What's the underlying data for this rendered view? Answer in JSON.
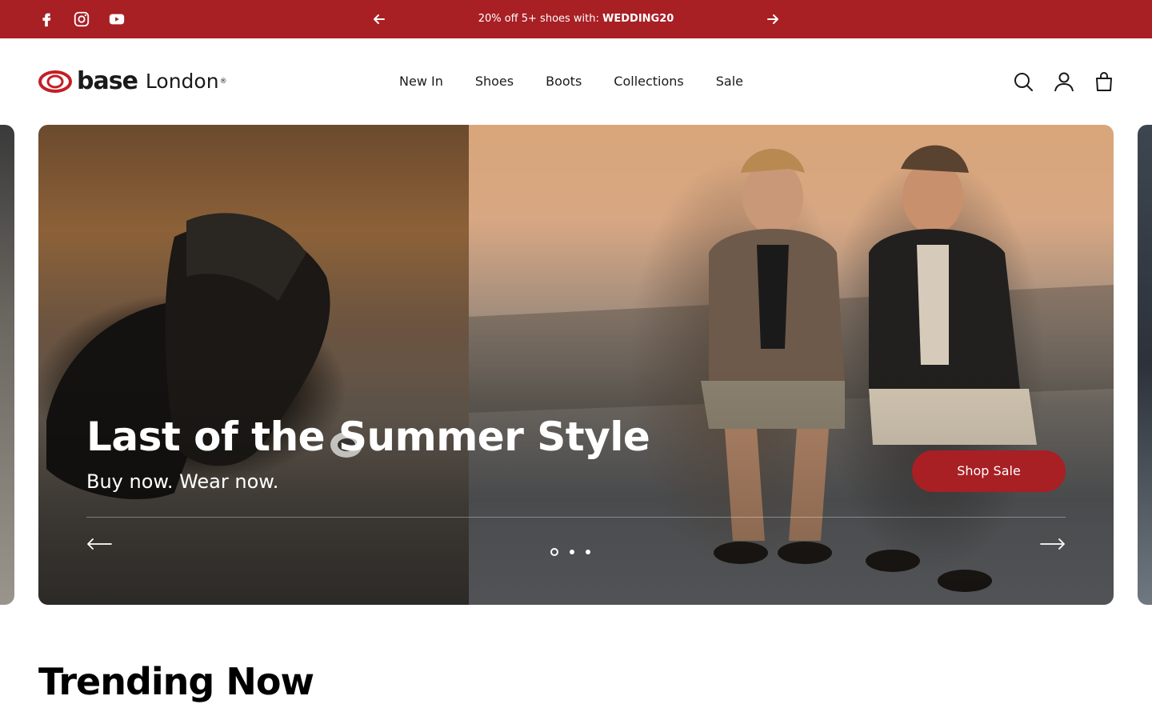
{
  "announcement": {
    "text_prefix": "20% off 5+ shoes with: ",
    "code": "WEDDING20",
    "background": "#a81f24"
  },
  "social": [
    {
      "name": "facebook-icon"
    },
    {
      "name": "instagram-icon"
    },
    {
      "name": "youtube-icon"
    }
  ],
  "brand": {
    "word1": "base",
    "word2": "London",
    "registered": "®",
    "accent": "#c41e26"
  },
  "nav": {
    "items": [
      "New In",
      "Shoes",
      "Boots",
      "Collections",
      "Sale"
    ]
  },
  "header_icons": [
    "search-icon",
    "account-icon",
    "bag-icon"
  ],
  "hero": {
    "title": "Last of the Summer Style",
    "subtitle": "Buy now. Wear now.",
    "cta": "Shop Sale",
    "cta_color": "#a81f24",
    "slide_count": 3,
    "active_slide": 1
  },
  "trending": {
    "title": "Trending Now"
  }
}
